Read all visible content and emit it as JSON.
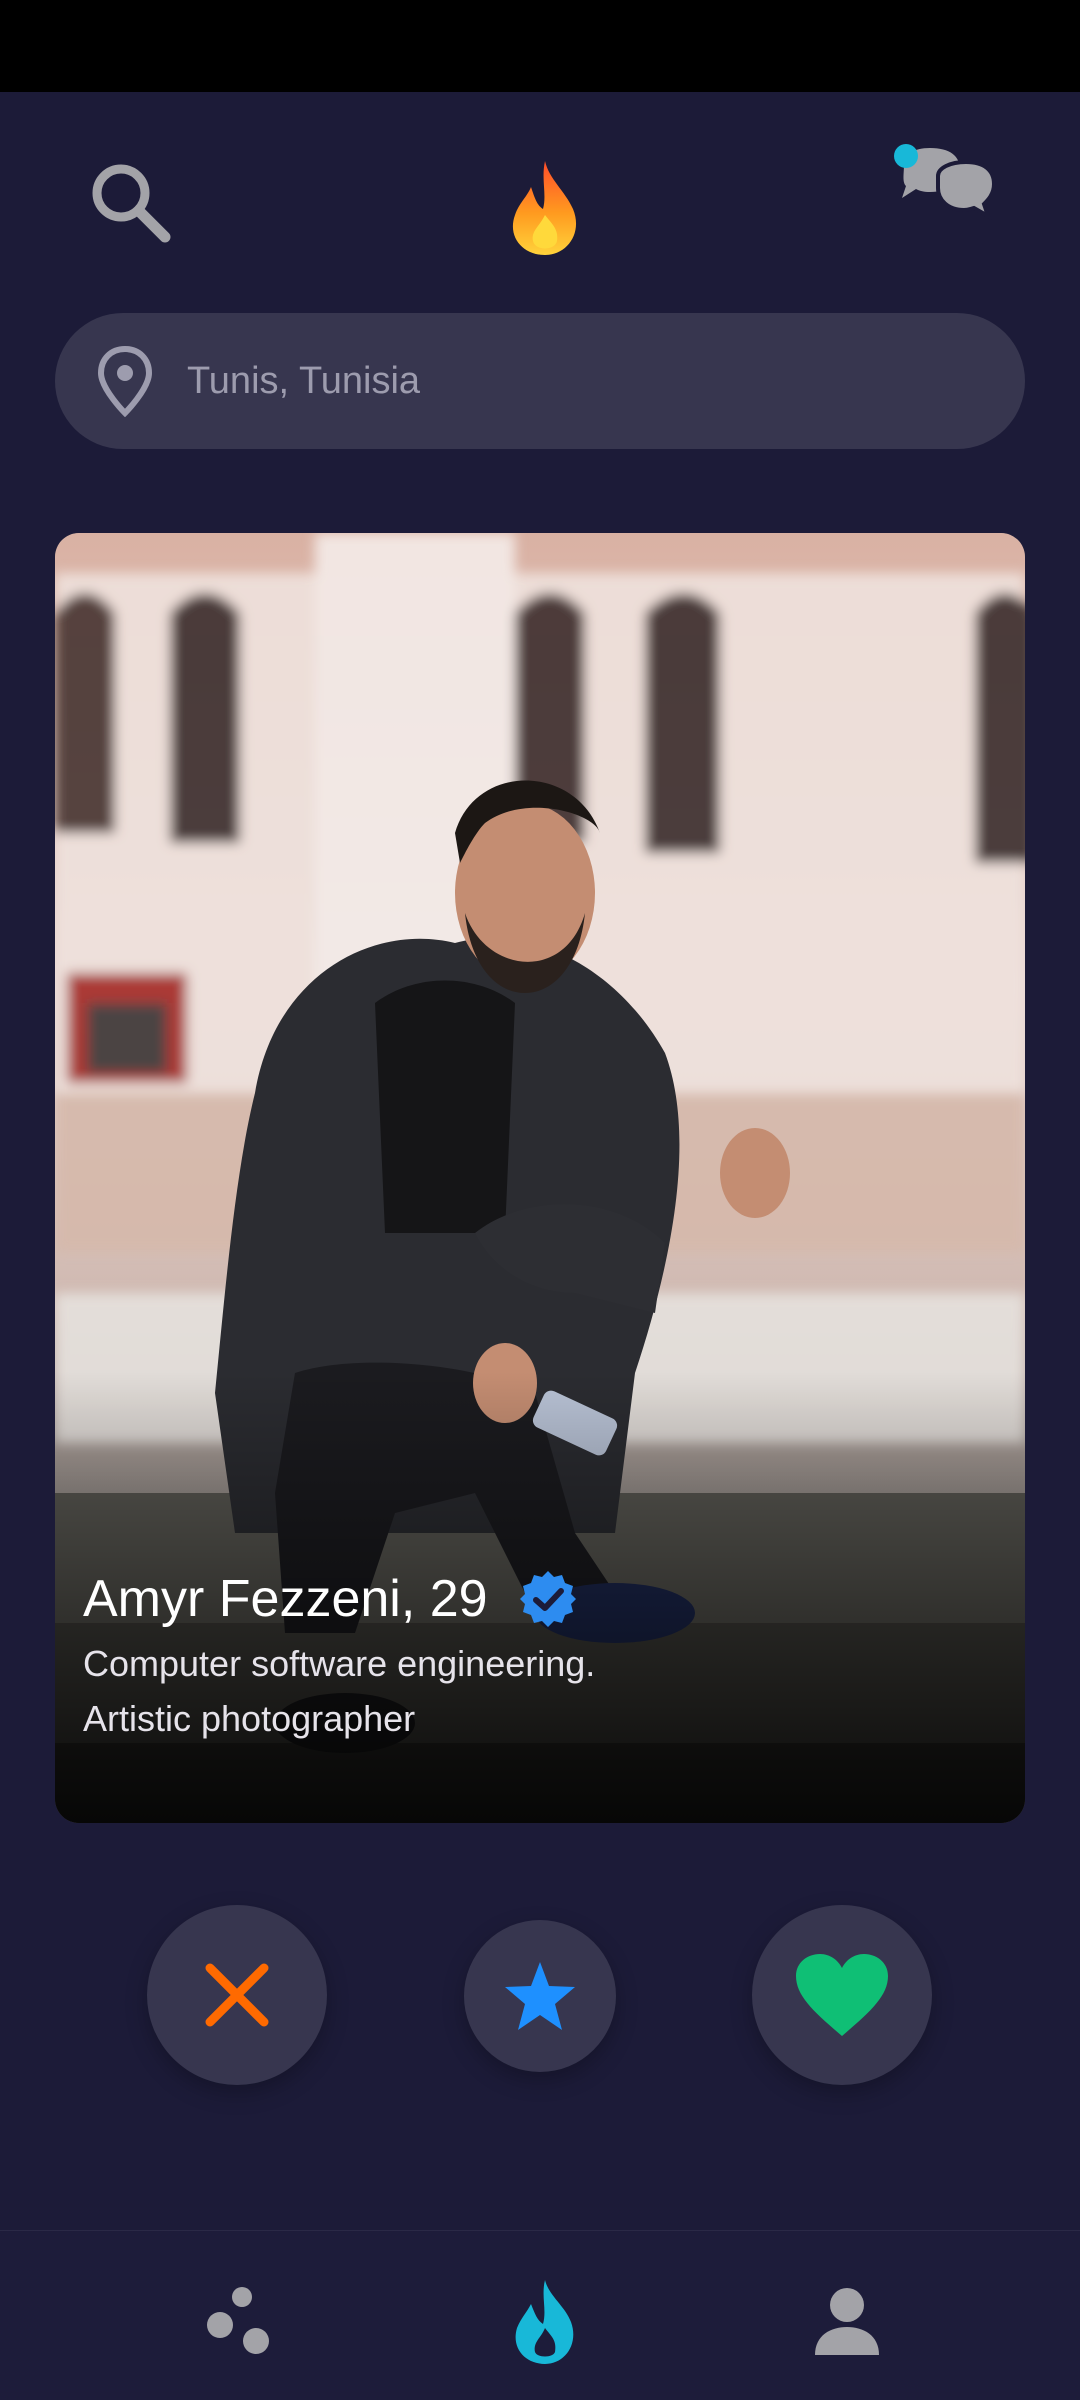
{
  "header": {
    "search_icon": "search-icon",
    "logo_icon": "flame-logo",
    "chat_icon": "chat-bubbles-icon"
  },
  "location": {
    "icon": "location-pin-icon",
    "value": "Tunis, Tunisia"
  },
  "profile_card": {
    "name_age": "Amyr Fezzeni, 29",
    "verified_icon": "verified-badge-icon",
    "bio_line1": "Computer software engineering.",
    "bio_line2": "Artistic photographer"
  },
  "actions": [
    {
      "name": "nope",
      "icon": "close-x-icon",
      "color": "#ff6a00"
    },
    {
      "name": "super-like",
      "icon": "star-icon",
      "color": "#1e90ff"
    },
    {
      "name": "like",
      "icon": "heart-icon",
      "color": "#0fbf75"
    }
  ],
  "bottom_nav": [
    {
      "name": "discover",
      "icon": "dots-icon",
      "active": false
    },
    {
      "name": "home",
      "icon": "flame-icon",
      "active": true
    },
    {
      "name": "profile",
      "icon": "person-icon",
      "active": false
    }
  ],
  "colors": {
    "background": "#1c1b38",
    "surface": "#37364f",
    "accent_teal": "#18b8d8",
    "nope_orange": "#ff6a00",
    "star_blue": "#1e90ff",
    "like_green": "#0fbf75",
    "verified_blue": "#2d8cf0"
  }
}
